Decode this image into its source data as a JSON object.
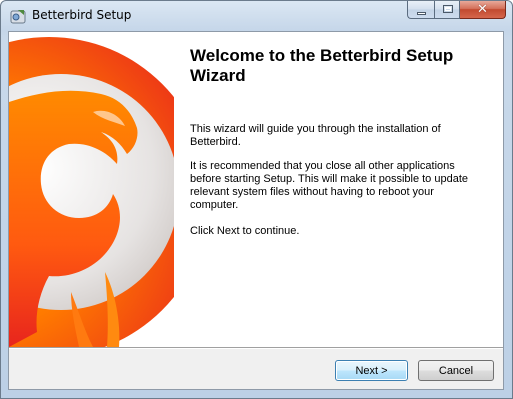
{
  "window": {
    "title": "Betterbird Setup",
    "close_glyph": "✕"
  },
  "wizard": {
    "heading": "Welcome to the Betterbird Setup Wizard",
    "paragraph1": "This wizard will guide you through the installation of Betterbird.",
    "paragraph2": "It is recommended that you close all other applications before starting Setup. This will make it possible to update relevant system files without having to reboot your computer.",
    "paragraph3": "Click Next to continue.",
    "image_icon": "betterbird-logo"
  },
  "buttons": {
    "next_label": "Next >",
    "cancel_label": "Cancel"
  },
  "colors": {
    "logo_orange": "#ff6a00",
    "logo_red": "#e8251d",
    "logo_yellow": "#ffb000",
    "next_border": "#3c7fb1"
  }
}
